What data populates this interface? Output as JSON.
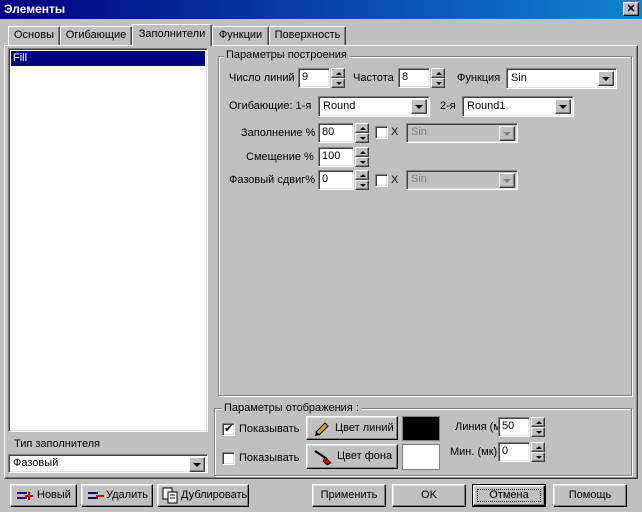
{
  "window": {
    "title": "Элементы",
    "close_glyph": "✕"
  },
  "tabs": [
    {
      "label": "Основы",
      "active": false
    },
    {
      "label": "Огибающие",
      "active": false
    },
    {
      "label": "Заполнители",
      "active": true
    },
    {
      "label": "Функции",
      "active": false
    },
    {
      "label": "Поверхность",
      "active": false
    }
  ],
  "fill_list": {
    "items": [
      "Fill"
    ],
    "selected": "Fill"
  },
  "filler_type": {
    "label": "Тип заполнителя",
    "value": "Фазовый"
  },
  "build_params": {
    "title": "Параметры построения",
    "line_count_label": "Число линий",
    "line_count_value": "9",
    "frequency_label": "Частота",
    "frequency_value": "8",
    "function_label": "Функция",
    "function_value": "Sin",
    "envelopes_label": "Огибающие: 1-я",
    "envelope1_value": "Round",
    "envelope2_label": "2-я",
    "envelope2_value": "Round1",
    "fill_label": "Заполнение %",
    "fill_value": "80",
    "fill_x_label": "X",
    "fill_x_func": "Sin",
    "offset_label": "Смещение %",
    "offset_value": "100",
    "phase_label": "Фазовый сдвиг%",
    "phase_value": "0",
    "phase_x_label": "X",
    "phase_x_func": "Sin"
  },
  "display_params": {
    "title": "Параметры отображения :",
    "show1_label": "Показывать",
    "show1_checked": true,
    "line_color_button": "Цвет линий",
    "line_color": "#000000",
    "show2_label": "Показывать",
    "show2_checked": false,
    "bg_color_button": "Цвет фона",
    "bg_color": "#ffffff",
    "line_width_label": "Линия (мк)",
    "line_width_value": "50",
    "min_label": "Мин. (мк)",
    "min_value": "0"
  },
  "footer": {
    "new_label": "Новый",
    "delete_label": "Удалить",
    "duplicate_label": "Дублировать",
    "apply_label": "Применить",
    "ok_label": "OK",
    "cancel_label": "Отмена",
    "help_label": "Помощь"
  }
}
